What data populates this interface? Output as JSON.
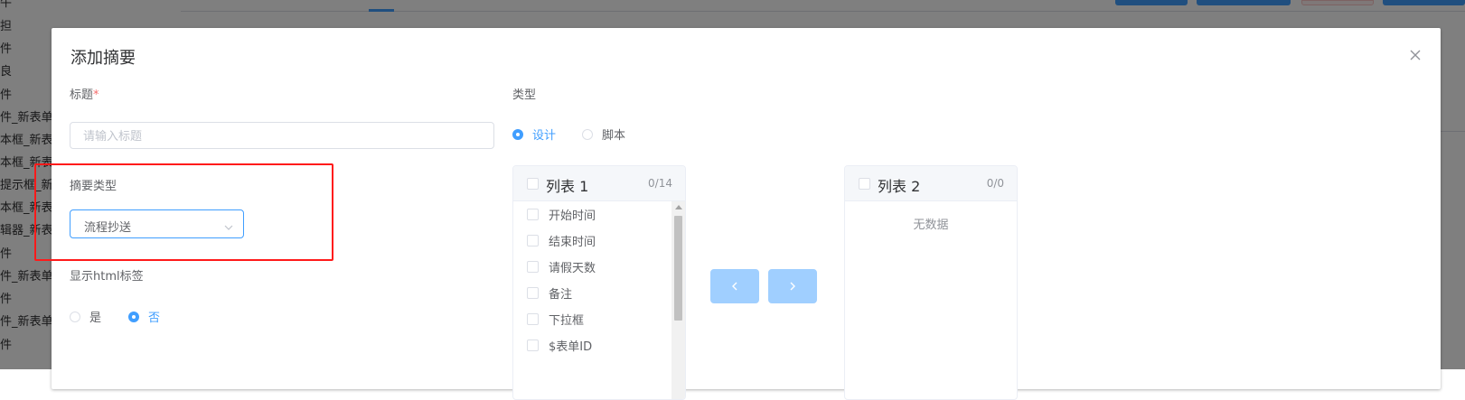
{
  "background": {
    "sidebar_items": [
      "牛",
      "担",
      "件",
      "良",
      "件",
      "件_新表单",
      "本框_新表单",
      "本框_新表单",
      "提示框_新",
      "本框_新表单",
      "辑器_新表",
      "件",
      "件_新表单",
      "件",
      "件_新表单",
      "件"
    ]
  },
  "dialog": {
    "title": "添加摘要",
    "title_field": {
      "label": "标题",
      "required_mark": "*",
      "placeholder": "请输入标题",
      "value": ""
    },
    "type_field": {
      "label": "类型",
      "options": [
        {
          "label": "设计",
          "checked": true
        },
        {
          "label": "脚本",
          "checked": false
        }
      ]
    },
    "summary_type_field": {
      "label": "摘要类型",
      "selected": "流程抄送"
    },
    "html_tag_field": {
      "label": "显示html标签",
      "options": [
        {
          "label": "是",
          "checked": false
        },
        {
          "label": "否",
          "checked": true
        }
      ]
    },
    "transfer": {
      "left": {
        "title": "列表 1",
        "count": "0/14",
        "items": [
          "开始时间",
          "结束时间",
          "请假天数",
          "备注",
          "下拉框",
          "$表单ID"
        ]
      },
      "right": {
        "title": "列表 2",
        "count": "0/0",
        "empty_text": "无数据"
      }
    }
  },
  "colors": {
    "accent": "#409eff",
    "highlight_border": "#ff1a1a",
    "disabled_button": "#a0cfff"
  }
}
